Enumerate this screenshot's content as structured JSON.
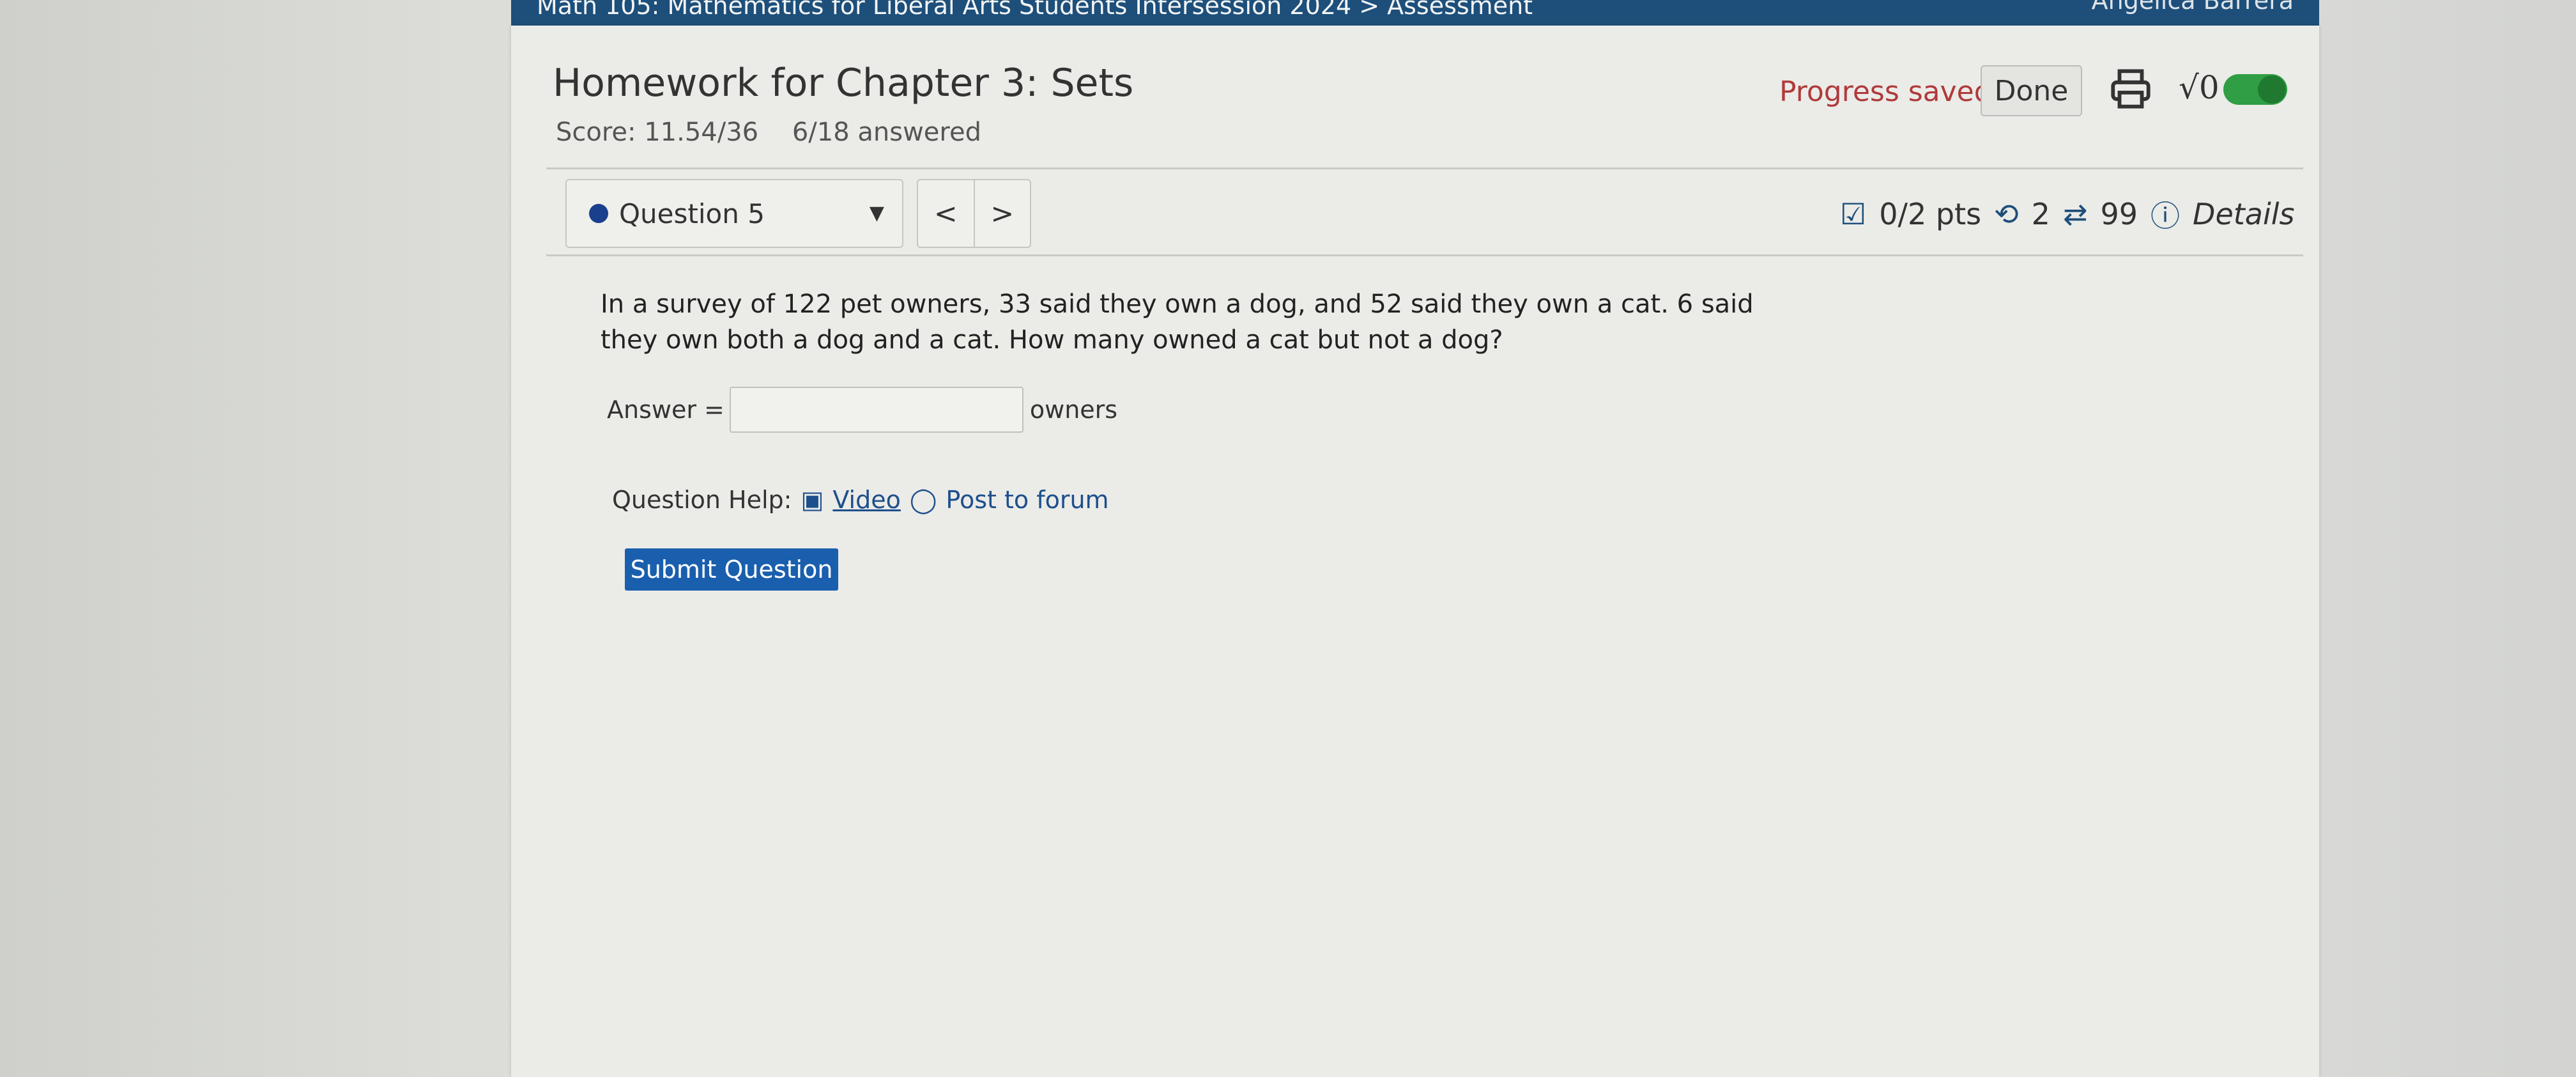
{
  "topbar": {
    "course": "Math 105: Mathematics for Liberal Arts Students Intersession 2024 > Assessment",
    "user": "Angelica Barrera"
  },
  "header": {
    "title": "Homework for Chapter 3: Sets",
    "score": "Score: 11.54/36",
    "answered": "6/18 answered",
    "progress_saved": "Progress saved",
    "done_label": "Done",
    "sqrt_label": "√0"
  },
  "question_nav": {
    "selected": "Question 5",
    "prev": "<",
    "next": ">"
  },
  "meta": {
    "points": "0/2 pts",
    "attempts": "2",
    "versions": "99",
    "details": "Details"
  },
  "question": {
    "text": "In a survey of 122 pet owners, 33 said they own a dog, and 52 said they own a cat. 6 said they own both a dog and a cat. How many owned a cat but not a dog?",
    "answer_label": "Answer =",
    "answer_value": "",
    "unit": "owners"
  },
  "help": {
    "label": "Question Help:",
    "video": "Video",
    "forum": "Post to forum"
  },
  "submit_label": "Submit Question",
  "colors": {
    "topbar": "#1d4f7a",
    "submit": "#1a5fae",
    "progress_saved": "#b03a3a",
    "toggle": "#2f9e44"
  }
}
